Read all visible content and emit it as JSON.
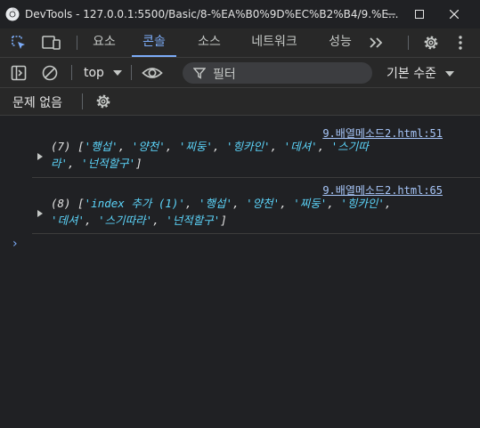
{
  "window": {
    "title": "DevTools - 127.0.0.1:5500/Basic/8-%EA%B0%9D%EC%B2%B4/9.%E..."
  },
  "tabs": [
    {
      "label": "요소"
    },
    {
      "label": "콘솔",
      "active": true
    },
    {
      "label": "소스"
    },
    {
      "label": "네트워크"
    },
    {
      "label": "성능"
    }
  ],
  "toolbar": {
    "context": "top",
    "filter_placeholder": "필터",
    "levels": "기본 수준"
  },
  "issues": {
    "label": "문제 없음"
  },
  "console": {
    "messages": [
      {
        "source": "9.배열메소드2.html:51",
        "line1_prefix": "(7) [",
        "line1_items": [
          "'행섭'",
          "'양천'",
          "'찌둥'",
          "'힝카인'",
          "'데셔'",
          "'스기따"
        ],
        "line2_items": [
          "라'",
          "'넌적할구'"
        ],
        "suffix": "]"
      },
      {
        "source": "9.배열메소드2.html:65",
        "line1_prefix": "(8) [",
        "line1_items": [
          "'index 추가 (1)'",
          "'행섭'",
          "'양천'",
          "'찌둥'",
          "'힝카인'"
        ],
        "line2_items": [
          "'데셔'",
          "'스기따라'",
          "'넌적할구'"
        ],
        "suffix": "]"
      }
    ],
    "prompt_symbol": "›"
  },
  "colors": {
    "background": "#202124",
    "accent": "#7cacf8",
    "string": "#5cd5fb",
    "link": "#a8c7fa"
  }
}
